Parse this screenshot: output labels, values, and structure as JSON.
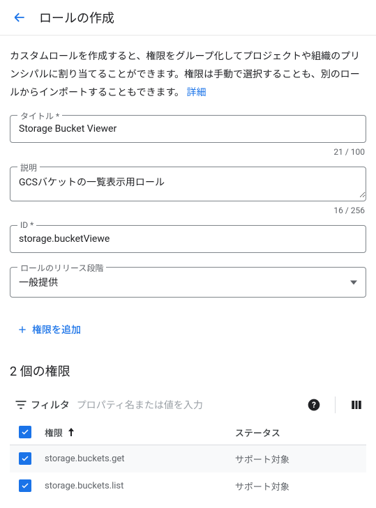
{
  "header": {
    "title": "ロールの作成"
  },
  "intro": {
    "text": "カスタムロールを作成すると、権限をグループ化してプロジェクトや組織のプリンシパルに割り当てることができます。権限は手動で選択することも、別のロールからインポートすることもできます。",
    "link": "詳細"
  },
  "fields": {
    "title": {
      "label": "タイトル *",
      "value": "Storage Bucket Viewer",
      "counter": "21 / 100"
    },
    "description": {
      "label": "説明",
      "value": "GCSバケットの一覧表示用ロール",
      "counter": "16 / 256"
    },
    "id": {
      "label": "ID *",
      "value": "storage.bucketViewe"
    },
    "stage": {
      "label": "ロールのリリース段階",
      "value": "一般提供"
    }
  },
  "addPermissionsBtn": "権限を追加",
  "permissions": {
    "title": "2 個の権限",
    "filterLabel": "フィルタ",
    "filterPlaceholder": "プロパティ名または値を入力",
    "columns": {
      "permission": "権限",
      "status": "ステータス"
    },
    "rows": [
      {
        "permission": "storage.buckets.get",
        "status": "サポート対象"
      },
      {
        "permission": "storage.buckets.list",
        "status": "サポート対象"
      }
    ]
  }
}
